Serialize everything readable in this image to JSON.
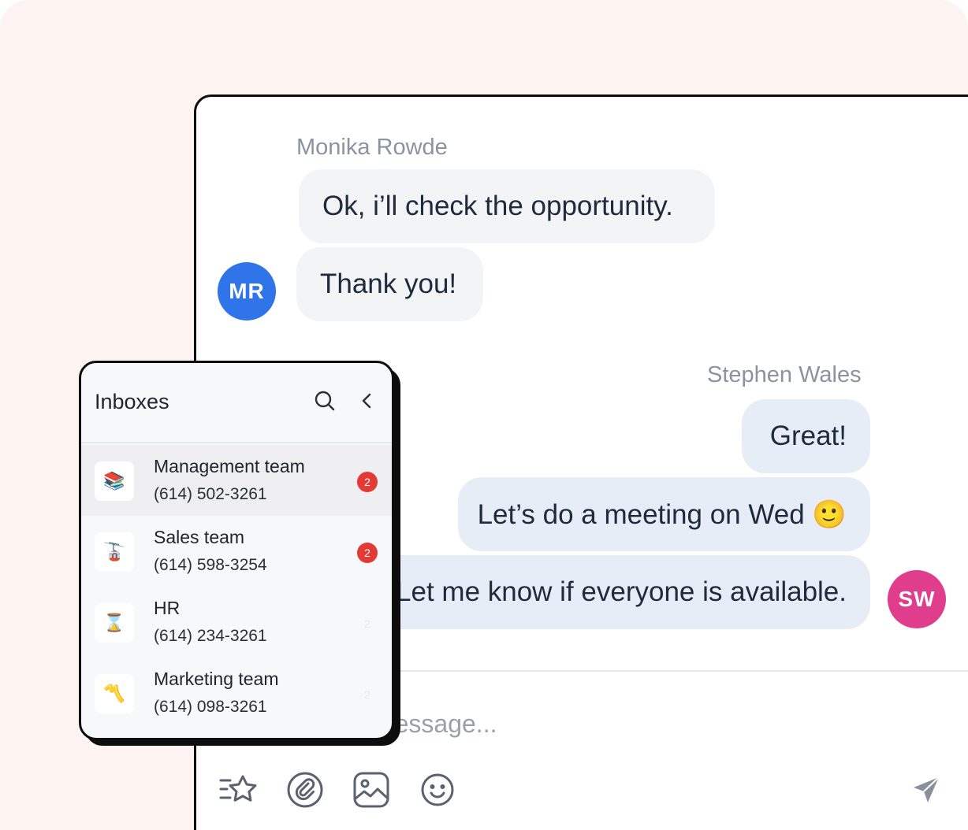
{
  "colors": {
    "background": "#fdf3f1",
    "avatar_mr": "#2f74e8",
    "avatar_sw": "#e03d8c",
    "incoming_bubble": "#f3f4f6",
    "outgoing_bubble": "#e6edf7",
    "badge": "#e53935"
  },
  "chat": {
    "incoming": {
      "sender": "Monika Rowde",
      "avatar_initials": "MR",
      "messages": [
        "Ok, i’ll check the opportunity.",
        "Thank you!"
      ]
    },
    "outgoing": {
      "sender": "Stephen Wales",
      "avatar_initials": "SW",
      "messages": [
        "Great!",
        "Let’s do a meeting on Wed 🙂",
        "Let me know if everyone is available."
      ]
    },
    "composer_placeholder": "Type a message...",
    "toolbar": [
      {
        "icon": "sparkle-star-icon"
      },
      {
        "icon": "attachment-icon"
      },
      {
        "icon": "image-icon"
      },
      {
        "icon": "emoji-icon"
      },
      {
        "icon": "send-icon"
      }
    ]
  },
  "inboxes": {
    "title": "Inboxes",
    "items": [
      {
        "name": "Management team",
        "phone": "(614) 502-3261",
        "icon_glyph": "📚",
        "badge": "2",
        "active": true
      },
      {
        "name": "Sales team",
        "phone": "(614) 598-3254",
        "icon_glyph": "🚡",
        "badge": "2",
        "active": false
      },
      {
        "name": "HR",
        "phone": "(614) 234-3261",
        "icon_glyph": "⌛",
        "badge": "2",
        "active": false
      },
      {
        "name": "Marketing team",
        "phone": "(614) 098-3261",
        "icon_glyph": "〽️",
        "badge": "2",
        "active": false
      }
    ]
  }
}
